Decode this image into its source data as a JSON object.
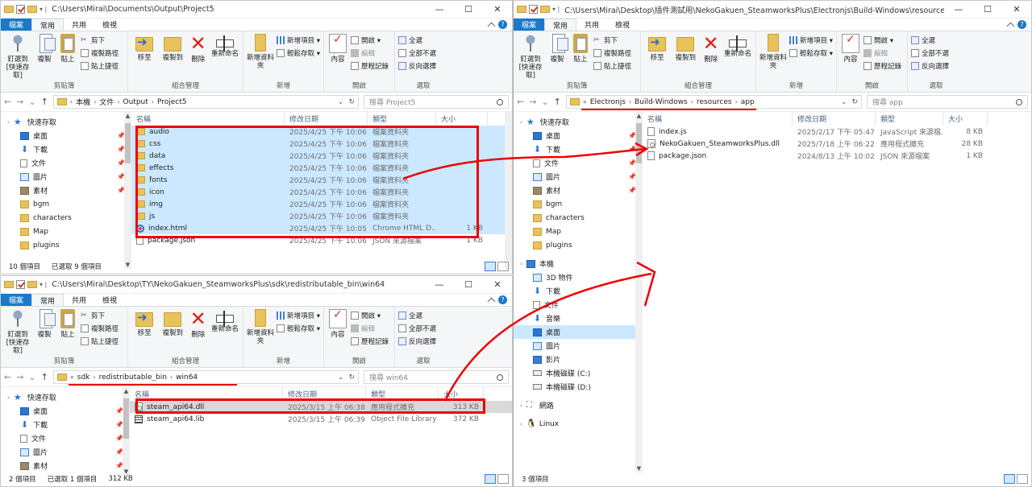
{
  "ribbon": {
    "tabs": [
      "檔案",
      "常用",
      "共用",
      "檢視"
    ],
    "pin_quick": "釘選到 [快速存取]",
    "copy": "複製",
    "paste": "貼上",
    "cut": "剪下",
    "copy_path": "複製路徑",
    "paste_shortcut": "貼上捷徑",
    "clipboard": "剪貼簿",
    "move_to": "移至",
    "copy_to": "複製到",
    "delete": "刪除",
    "rename": "重新命名",
    "organize": "組合管理",
    "new_folder": "新增資料夾",
    "new_item": "新增項目",
    "easy_access": "輕鬆存取",
    "new": "新增",
    "properties": "內容",
    "open": "開啟",
    "edit": "編輯",
    "history": "歷程記錄",
    "open_group": "開啟",
    "select_all": "全選",
    "select_none": "全部不選",
    "invert": "反向選擇",
    "select": "選取"
  },
  "headers": {
    "name": "名稱",
    "date": "修改日期",
    "type": "類型",
    "size": "大小"
  },
  "w1": {
    "title": "C:\\Users\\Mirai\\Documents\\Output\\Project5",
    "crumbs": [
      "本機",
      "文件",
      "Output",
      "Project5"
    ],
    "search": "搜尋 Project5",
    "nav": [
      {
        "label": "快速存取",
        "icon": "star"
      },
      {
        "label": "桌面",
        "icon": "desk",
        "pin": "📌"
      },
      {
        "label": "下載",
        "icon": "dl",
        "pin": "📌"
      },
      {
        "label": "文件",
        "icon": "doc",
        "pin": "📌"
      },
      {
        "label": "圖片",
        "icon": "pic",
        "pin": "📌"
      },
      {
        "label": "素材",
        "icon": "mat",
        "pin": "📌"
      },
      {
        "label": "bgm",
        "icon": "f"
      },
      {
        "label": "characters",
        "icon": "f"
      },
      {
        "label": "Map",
        "icon": "f"
      },
      {
        "label": "plugins",
        "icon": "f"
      }
    ],
    "rows": [
      {
        "name": "audio",
        "date": "2025/4/25 下午 10:06",
        "type": "檔案資料夾",
        "size": "",
        "icon": "f"
      },
      {
        "name": "css",
        "date": "2025/4/25 下午 10:06",
        "type": "檔案資料夾",
        "size": "",
        "icon": "f"
      },
      {
        "name": "data",
        "date": "2025/4/25 下午 10:06",
        "type": "檔案資料夾",
        "size": "",
        "icon": "f"
      },
      {
        "name": "effects",
        "date": "2025/4/25 下午 10:06",
        "type": "檔案資料夾",
        "size": "",
        "icon": "f"
      },
      {
        "name": "fonts",
        "date": "2025/4/25 下午 10:06",
        "type": "檔案資料夾",
        "size": "",
        "icon": "f"
      },
      {
        "name": "icon",
        "date": "2025/4/25 下午 10:06",
        "type": "檔案資料夾",
        "size": "",
        "icon": "f"
      },
      {
        "name": "img",
        "date": "2025/4/25 下午 10:06",
        "type": "檔案資料夾",
        "size": "",
        "icon": "f"
      },
      {
        "name": "js",
        "date": "2025/4/25 下午 10:06",
        "type": "檔案資料夾",
        "size": "",
        "icon": "f"
      },
      {
        "name": "index.html",
        "date": "2025/4/25 下午 10:05",
        "type": "Chrome HTML D...",
        "size": "1 KB",
        "icon": "e"
      },
      {
        "name": "package.json",
        "date": "2025/4/25 下午 10:06",
        "type": "JSON 來源檔案",
        "size": "1 KB",
        "icon": "d"
      }
    ],
    "status_count": "10 個項目",
    "status_sel": "已選取 9 個項目"
  },
  "w2": {
    "title": "C:\\Users\\Mirai\\Desktop\\TY\\NekoGakuen_SteamworksPlus\\sdk\\redistributable_bin\\win64",
    "crumbs": [
      "sdk",
      "redistributable_bin",
      "win64"
    ],
    "search": "搜尋 win64",
    "nav": [
      {
        "label": "快速存取",
        "icon": "star"
      },
      {
        "label": "桌面",
        "icon": "desk",
        "pin": "📌"
      },
      {
        "label": "下載",
        "icon": "dl",
        "pin": "📌"
      },
      {
        "label": "文件",
        "icon": "doc",
        "pin": "📌"
      },
      {
        "label": "圖片",
        "icon": "pic",
        "pin": "📌"
      },
      {
        "label": "素材",
        "icon": "mat",
        "pin": "📌"
      }
    ],
    "rows": [
      {
        "name": "steam_api64.dll",
        "date": "2025/3/15 上午 06:38",
        "type": "應用程式擴充",
        "size": "313 KB",
        "icon": "dll"
      },
      {
        "name": "steam_api64.lib",
        "date": "2025/3/15 上午 06:39",
        "type": "Object File Library",
        "size": "372 KB",
        "icon": "lib"
      }
    ],
    "status_count": "2 個項目",
    "status_sel": "已選取 1 個項目",
    "status_size": "312 KB"
  },
  "w3": {
    "title": "C:\\Users\\Mirai\\Desktop\\插件測試用\\NekoGakuen_SteamworksPlus\\Electronjs\\Build-Windows\\resources\\app",
    "crumbs": [
      "Electronjs",
      "Build-Windows",
      "resources",
      "app"
    ],
    "search": "搜尋 app",
    "nav": [
      {
        "label": "快速存取",
        "icon": "star",
        "hdr": true
      },
      {
        "label": "桌面",
        "icon": "desk",
        "pin": "📌"
      },
      {
        "label": "下載",
        "icon": "dl",
        "pin": "📌"
      },
      {
        "label": "文件",
        "icon": "doc",
        "pin": "📌"
      },
      {
        "label": "圖片",
        "icon": "pic",
        "pin": "📌"
      },
      {
        "label": "素材",
        "icon": "mat",
        "pin": "📌"
      },
      {
        "label": "bgm",
        "icon": "f"
      },
      {
        "label": "characters",
        "icon": "f"
      },
      {
        "label": "Map",
        "icon": "f"
      },
      {
        "label": "plugins",
        "icon": "f"
      },
      {
        "label": "",
        "icon": "",
        "gap": true
      },
      {
        "label": "本機",
        "icon": "pc",
        "hdr": true
      },
      {
        "label": "3D 物件",
        "icon": "pic"
      },
      {
        "label": "下載",
        "icon": "dl"
      },
      {
        "label": "文件",
        "icon": "doc"
      },
      {
        "label": "音樂",
        "icon": "dl"
      },
      {
        "label": "桌面",
        "icon": "desk",
        "sel": true
      },
      {
        "label": "圖片",
        "icon": "pic"
      },
      {
        "label": "影片",
        "icon": "pc"
      },
      {
        "label": "本機磁碟 (C:)",
        "icon": "drv"
      },
      {
        "label": "本機磁碟 (D:)",
        "icon": "drv"
      },
      {
        "label": "",
        "icon": "",
        "gap": true
      },
      {
        "label": "網路",
        "icon": "net",
        "hdr": true
      },
      {
        "label": "",
        "icon": "",
        "gap": true
      },
      {
        "label": "Linux",
        "icon": "linux",
        "hdr": true
      }
    ],
    "rows": [
      {
        "name": "index.js",
        "date": "2025/2/17 下午 05:47",
        "type": "JavaScript 來源檔...",
        "size": "8 KB",
        "icon": "d"
      },
      {
        "name": "NekoGakuen_SteamworksPlus.dll",
        "date": "2025/7/18 上午 06:22",
        "type": "應用程式擴充",
        "size": "28 KB",
        "icon": "dll"
      },
      {
        "name": "package.json",
        "date": "2024/8/13 上午 10:02",
        "type": "JSON 來源檔案",
        "size": "1 KB",
        "icon": "d"
      }
    ],
    "status_count": "3 個項目"
  }
}
